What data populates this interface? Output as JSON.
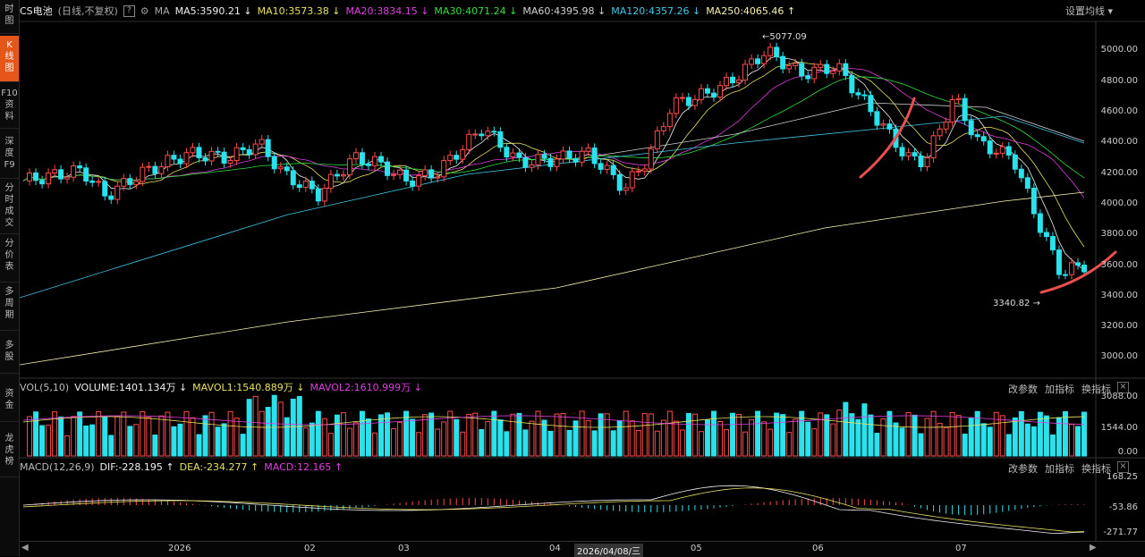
{
  "sidebar": {
    "items": [
      {
        "label": "时\n图"
      },
      {
        "label": "K\n线\n图"
      },
      {
        "label": "F10\n资\n料"
      },
      {
        "label": "深\n度\nF9"
      },
      {
        "label": "分\n时\n成\n交"
      },
      {
        "label": "分\n价\n表"
      },
      {
        "label": "多\n周\n期"
      },
      {
        "label": "多\n股"
      },
      {
        "label": "资\n金"
      },
      {
        "label": "龙\n虎\n榜"
      }
    ]
  },
  "toolbar": {
    "symbol": "CS电池",
    "mode": "(日线,不复权)",
    "help": "?",
    "ma_label": "MA",
    "ma5": "MA5:3590.21 ↓",
    "ma10": "MA10:3573.38 ↓",
    "ma20": "MA20:3834.15 ↓",
    "ma30": "MA30:4071.24 ↓",
    "ma60": "MA60:4395.98 ↓",
    "ma120": "MA120:4357.26 ↓",
    "ma250": "MA250:4065.46 ↑",
    "settings": "设置均线 ▾"
  },
  "price_axis": [
    "5000.00",
    "4800.00",
    "4600.00",
    "4400.00",
    "4200.00",
    "4000.00",
    "3800.00",
    "3600.00",
    "3400.00",
    "3200.00",
    "3000.00"
  ],
  "annotations": {
    "high": "←5077.09",
    "low": "3340.82 →"
  },
  "vol_panel": {
    "title": "VOL(5,10)",
    "volume": "VOLUME:1401.134万 ↓",
    "mavol1": "MAVOL1:1540.889万 ↓",
    "mavol2": "MAVOL2:1610.999万 ↓",
    "axis": [
      "3088.00",
      "1544.00",
      "0.00"
    ]
  },
  "macd_panel": {
    "title": "MACD(12,26,9)",
    "dif": "DIF:-228.195 ↑",
    "dea": "DEA:-234.277 ↑",
    "macd": "MACD:12.165 ↑",
    "axis": [
      "168.25",
      "-53.86",
      "-271.77"
    ]
  },
  "panel_tools": {
    "params": "改参数",
    "add": "加指标",
    "swap": "换指标",
    "close": "×"
  },
  "xaxis": {
    "labels": [
      "2026",
      "02",
      "03",
      "04",
      "2026/04/08/三",
      "05",
      "06",
      "07"
    ]
  },
  "colors": {
    "up": "#ff4a4a",
    "down": "#29e2ec",
    "ma5": "#f0f0f0",
    "ma10": "#e8e060",
    "ma20": "#e040e0",
    "ma30": "#30e040",
    "ma60": "#d0d0d0",
    "ma120": "#40c8e8",
    "ma250": "#f8f0b0",
    "annotation_stroke": "#e85050"
  }
}
